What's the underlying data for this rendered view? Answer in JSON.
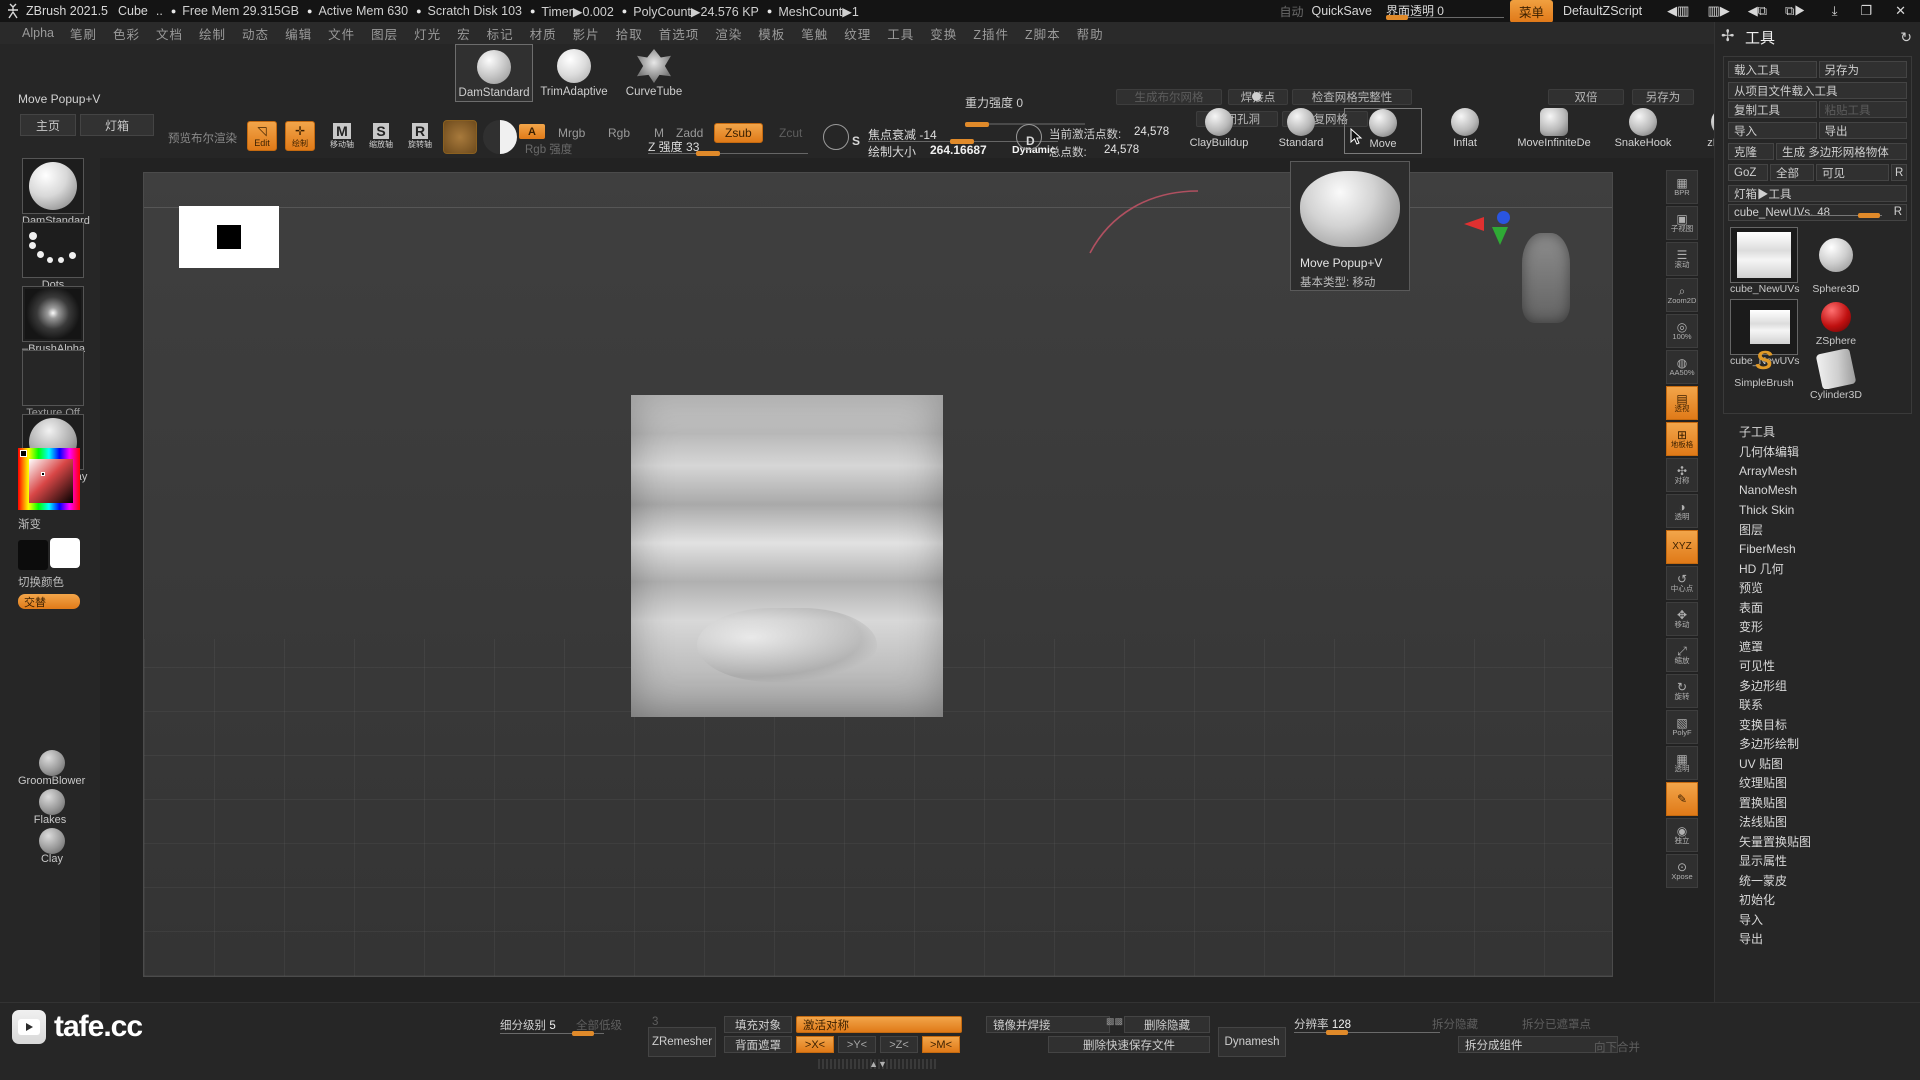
{
  "titlebar": {
    "app_title": "ZBrush 2021.5",
    "doc_name": "Cube",
    "ellipsis": "..",
    "stats": [
      "Free Mem 29.315GB",
      "Active Mem 630",
      "Scratch Disk 103",
      "Timer▶0.002",
      "PolyCount▶24.576 KP",
      "MeshCount▶1"
    ],
    "auto_label": "自动",
    "quicksave_label": "QuickSave",
    "transparency_label": "界面透明",
    "transparency_value": "0",
    "menu_button": "菜单",
    "zscript_label": "DefaultZScript",
    "icons": [
      "prev-tray-icon",
      "next-tray-icon",
      "prev-window-icon",
      "next-window-icon",
      "minimize-icon",
      "restore-icon",
      "close-icon"
    ]
  },
  "menubar": {
    "items": [
      "Alpha",
      "笔刷",
      "色彩",
      "文档",
      "绘制",
      "动态",
      "编辑",
      "文件",
      "图层",
      "灯光",
      "宏",
      "标记",
      "材质",
      "影片",
      "拾取",
      "首选项",
      "渲染",
      "模板",
      "笔触",
      "纹理",
      "工具",
      "变换",
      "Z插件",
      "Z脚本",
      "帮助"
    ]
  },
  "toolbar": {
    "recent_brushes": [
      {
        "label": "DamStandard",
        "selected": true
      },
      {
        "label": "TrimAdaptive",
        "selected": false
      },
      {
        "label": "CurveTube",
        "selected": false
      }
    ],
    "gravity_label": "重力强度",
    "gravity_value": "0",
    "boolean_render_label": "生成布尔网格",
    "weld_points_label": "焊接点",
    "check_mesh_label": "检查网格完整性",
    "close_holes_label": "封闭孔洞",
    "repair_mesh_label": "修复网格",
    "double_label": "双倍",
    "saveas_label": "另存为",
    "preview_render_label": "预览布尔渲染",
    "edit_label": "Edit",
    "draw_label": "绘制",
    "move_axis_label": "移动轴",
    "scale_axis_label": "缩放轴",
    "rotate_axis_label": "旋转轴",
    "move_glyph": "M",
    "scale_glyph": "S",
    "rotate_glyph": "R",
    "alpha_toggle": "A",
    "mrgb_label": "Mrgb",
    "rgb_label": "Rgb",
    "m_label": "M",
    "zadd_label": "Zadd",
    "zsub_label": "Zsub",
    "zcut_label": "Zcut",
    "rgb_intensity_label": "Rgb 强度",
    "z_intensity_label": "Z 强度",
    "z_intensity_value": "33",
    "focal_shift_label": "焦点衰减",
    "focal_shift_value": "-14",
    "draw_size_label": "绘制大小",
    "draw_size_value": "264.16687",
    "dynamic_label": "Dynamic",
    "s_glyph": "S",
    "d_glyph": "D",
    "active_points_label": "当前激活点数:",
    "active_points_value": "24,578",
    "total_points_label": "总点数:",
    "total_points_value": "24,578",
    "brush_slots": [
      {
        "label": "ClayBuildup",
        "selected": false
      },
      {
        "label": "Standard",
        "selected": false
      },
      {
        "label": "Move",
        "selected": true
      },
      {
        "label": "Inflat",
        "selected": false
      },
      {
        "label": "MoveInfiniteDe",
        "selected": false
      },
      {
        "label": "SnakeHook",
        "selected": false
      },
      {
        "label": "zPolish",
        "selected": false
      }
    ]
  },
  "leftpalette": {
    "popup_title": "Move Popup+V",
    "home_button": "主页",
    "lightbox_button": "灯箱",
    "items": [
      {
        "label": "DamStandard",
        "icon": "brush-sphere-icon"
      },
      {
        "label": "Dots",
        "icon": "stroke-dots-icon"
      },
      {
        "label": "–BrushAlpha",
        "icon": "alpha-glow-icon"
      },
      {
        "label": "Texture Off",
        "icon": "texture-off-icon"
      },
      {
        "label": "MatCap Gray",
        "icon": "material-sphere-icon"
      }
    ],
    "gradient_label": "渐变",
    "switch_color_label": "切换颜色",
    "alt_label": "交替",
    "small_items": [
      {
        "label": "GroomBlower"
      },
      {
        "label": "Flakes"
      },
      {
        "label": "Clay"
      }
    ]
  },
  "popup": {
    "title": "Move  Popup+V",
    "subtitle": "基本类型: 移动"
  },
  "rail": {
    "buttons": [
      {
        "glyph": "▦",
        "text": "BPR",
        "active": false,
        "name": "bpr-render-button"
      },
      {
        "glyph": "▣",
        "text": "子视图",
        "active": false,
        "name": "subview-button"
      },
      {
        "glyph": "☰",
        "text": "滚动",
        "active": false,
        "name": "scroll-button"
      },
      {
        "glyph": "⌕",
        "text": "Zoom2D",
        "active": false,
        "name": "zoom2d-button"
      },
      {
        "glyph": "◎",
        "text": "100%",
        "active": false,
        "name": "actual-size-button"
      },
      {
        "glyph": "◍",
        "text": "AA50%",
        "active": false,
        "name": "aahalf-button"
      },
      {
        "glyph": "▤",
        "text": "透视",
        "active": true,
        "name": "perspective-button"
      },
      {
        "glyph": "⊞",
        "text": "地板格",
        "active": true,
        "name": "floor-button"
      },
      {
        "glyph": "✣",
        "text": "对称",
        "active": false,
        "name": "symmetry-button"
      },
      {
        "glyph": "◑",
        "text": "透明",
        "active": false,
        "name": "transparency-button"
      },
      {
        "glyph": "XYZ",
        "text": "",
        "active": true,
        "name": "xyz-button"
      },
      {
        "glyph": "↺",
        "text": "中心点",
        "active": false,
        "name": "frame-button"
      },
      {
        "glyph": "✥",
        "text": "移动",
        "active": false,
        "name": "move-button"
      },
      {
        "glyph": "⤢",
        "text": "缩放",
        "active": false,
        "name": "scale-button"
      },
      {
        "glyph": "↻",
        "text": "旋转",
        "active": false,
        "name": "rotate-button"
      },
      {
        "glyph": "▧",
        "text": "PolyF",
        "active": false,
        "name": "polyframe-button"
      },
      {
        "glyph": "▦",
        "text": "透明",
        "active": false,
        "name": "ghost-button"
      },
      {
        "glyph": "✎",
        "text": "",
        "active": true,
        "name": "edit-rail-button"
      },
      {
        "glyph": "◉",
        "text": "独立",
        "active": false,
        "name": "solo-button"
      },
      {
        "glyph": "⊙",
        "text": "Xpose",
        "active": false,
        "name": "xpose-button"
      }
    ]
  },
  "rightpanel": {
    "title": "工具",
    "refresh_icon": "refresh-icon",
    "buttons": {
      "load_tool": "载入工具",
      "save_as": "另存为",
      "load_from_project": "从项目文件载入工具",
      "copy_tool": "复制工具",
      "paste_tool": "粘贴工具",
      "import": "导入",
      "export": "导出",
      "clone": "克隆",
      "make_polymesh": "生成 多边形网格物体",
      "goz": "GoZ",
      "all": "全部",
      "visible": "可见",
      "r": "R",
      "lightbox_tool": "灯箱▶工具"
    },
    "slider": {
      "label": "cube_NewUVs.",
      "value": "48",
      "r": "R"
    },
    "thumbs": [
      {
        "label": "cube_NewUVs",
        "icon": "cube-thumb-icon",
        "selected": true
      },
      {
        "label": "Sphere3D",
        "icon": "sphere3d-icon",
        "selected": false
      },
      {
        "label": "cube_NewUVs",
        "icon": "cube-thumb-icon",
        "selected": true
      },
      {
        "label": "ZSphere",
        "icon": "zsphere-icon",
        "selected": false
      },
      {
        "label": "Cylinder3D",
        "icon": "cylinder3d-icon",
        "selected": false
      },
      {
        "label": "SimpleBrush",
        "icon": "simplebrush-icon",
        "selected": false
      }
    ],
    "sections": [
      "子工具",
      "几何体编辑",
      "ArrayMesh",
      "NanoMesh",
      "Thick Skin",
      "图层",
      "FiberMesh",
      "HD 几何",
      "预览",
      "表面",
      "变形",
      "遮罩",
      "可见性",
      "多边形组",
      "联系",
      "变换目标",
      "多边形绘制",
      "UV 贴图",
      "纹理贴图",
      "置换贴图",
      "法线贴图",
      "矢量置换贴图",
      "显示属性",
      "统一蒙皮",
      "初始化",
      "导入",
      "导出"
    ]
  },
  "bottombar": {
    "subdiv_label": "细分级别",
    "subdiv_value": "5",
    "all_low_label": "全部低级",
    "zremesher_label": "ZRemesher",
    "zr_num": "3",
    "fill_object_label": "填充对象",
    "activate_symmetry_label": "激活对称",
    "backface_mask_label": "背面遮罩",
    "axis_x": ">X<",
    "axis_y": ">Y<",
    "axis_z": ">Z<",
    "axis_m": ">M<",
    "mirror_weld_label": "镜像并焊接",
    "delete_hidden_label": "删除隐藏",
    "delete_quicksave_label": "删除快速保存文件",
    "dynamesh_label": "Dynamesh",
    "resolution_label": "分辨率",
    "resolution_value": "128",
    "split_hidden_label": "拆分隐藏",
    "split_unmasked_label": "拆分已遮罩点",
    "split_to_parts_label": "拆分成组件",
    "merge_down_label": "向下合并"
  },
  "watermark": {
    "text": "tafe.cc",
    "icon": "video-play-icon"
  },
  "colors": {
    "accent_orange": "#e07a18",
    "panel_bg": "#262626",
    "titlebar_bg": "#141414",
    "canvas_bg": "#3b3b3b",
    "text": "#c8c8c8"
  }
}
